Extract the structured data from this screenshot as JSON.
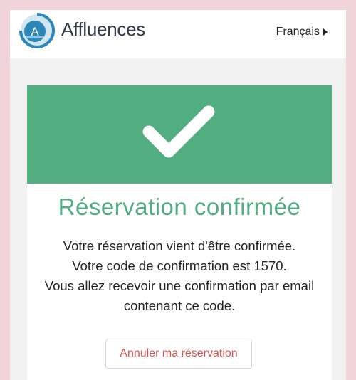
{
  "header": {
    "logo_text": "Affluences",
    "logo_letter": "A",
    "language_label": "Français"
  },
  "confirmation": {
    "title": "Réservation confirmée",
    "line1": "Votre réservation vient d'être confirmée.",
    "line2_prefix": "Votre code de confirmation est ",
    "code": "1570",
    "line2_suffix": ".",
    "line3": "Vous allez recevoir une confirmation par email",
    "line4": "contenant ce code.",
    "cancel_label": "Annuler ma réservation"
  },
  "colors": {
    "page_background": "#f0d2d9",
    "accent_green": "#52ad80",
    "danger_red": "#d9534f",
    "logo_blue": "#2c86b8"
  },
  "icons": {
    "logo": "affluences-logo-icon",
    "banner": "checkmark-icon",
    "language": "caret-right-icon"
  }
}
